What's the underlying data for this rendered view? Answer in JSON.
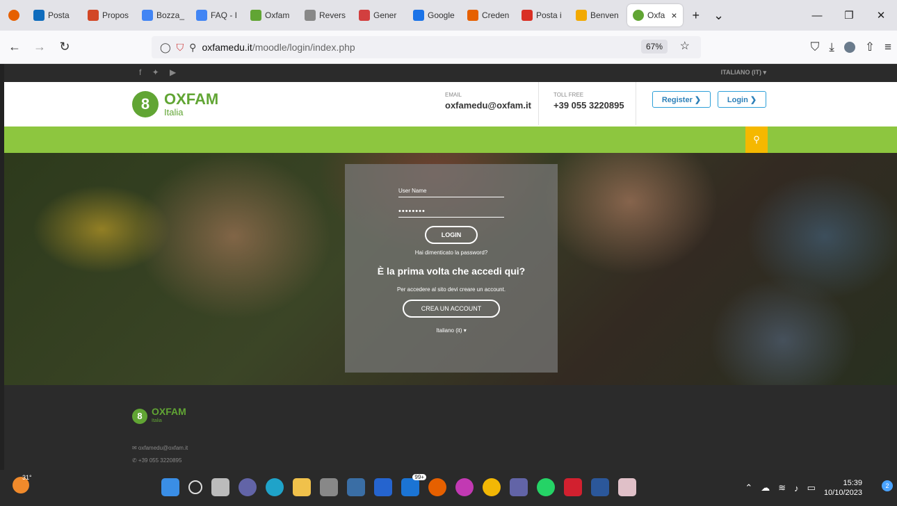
{
  "browser": {
    "tabs": [
      {
        "label": "Posta",
        "color": "#0f6cbd"
      },
      {
        "label": "Propos",
        "color": "#d24726"
      },
      {
        "label": "Bozza_",
        "color": "#4285f4"
      },
      {
        "label": "FAQ - I",
        "color": "#4285f4"
      },
      {
        "label": "Oxfam",
        "color": "#61a534"
      },
      {
        "label": "Revers",
        "color": "#888888"
      },
      {
        "label": "Gener",
        "color": "#d23f3f"
      },
      {
        "label": "Google",
        "color": "#1a73e8"
      },
      {
        "label": "Creden",
        "color": "#e66000"
      },
      {
        "label": "Posta i",
        "color": "#d93025"
      },
      {
        "label": "Benven",
        "color": "#f2a900"
      }
    ],
    "active_tab": {
      "label": "Oxfa",
      "close": "×"
    },
    "new_tab": "+",
    "url_domain": "oxfamedu.it",
    "url_path": "/moodle/login/index.php",
    "zoom": "67%"
  },
  "site": {
    "language": "ITALIANO (IT) ▾",
    "logo_title": "OXFAM",
    "logo_sub": "Italia",
    "email_label": "EMAIL",
    "email_value": "oxfamedu@oxfam.it",
    "tollfree_label": "TOLL FREE",
    "tollfree_value": "+39 055 3220895",
    "register_label": "Register ❯",
    "login_label": "Login ❯",
    "colors": {
      "green": "#8dc63f",
      "logo_green": "#61a534",
      "search": "#f5b800",
      "button_blue": "#2b9fd8"
    }
  },
  "login_box": {
    "username_placeholder": "User Name",
    "password_masked": "••••••••",
    "login_button": "LOGIN",
    "forgot_link": "Hai dimenticato la password?",
    "first_time_heading": "È la prima volta che accedi qui?",
    "info_text": "Per accedere al sito devi creare un account.",
    "create_button": "CREA UN ACCOUNT",
    "language_select": "Italiano (it) ▾"
  },
  "footer": {
    "logo_title": "OXFAM",
    "logo_sub": "Italia",
    "email": "✉ oxfamedu@oxfam.it",
    "phone": "✆ +39 055 3220895"
  },
  "taskbar": {
    "temperature": "31°",
    "badge": "99+",
    "time": "15:39",
    "date": "10/10/2023",
    "notifications": "2"
  }
}
